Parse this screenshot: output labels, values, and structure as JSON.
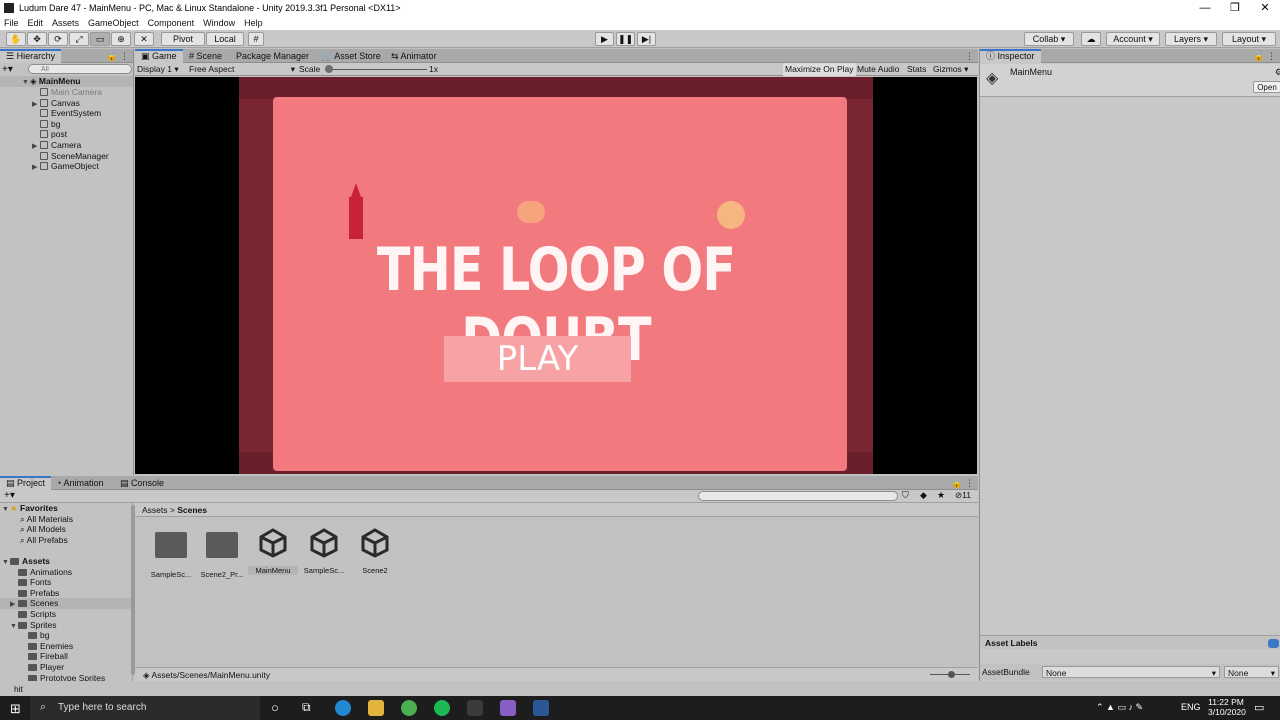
{
  "window": {
    "title": "Ludum Dare 47 - MainMenu - PC, Mac & Linux Standalone - Unity 2019.3.3f1 Personal <DX11>",
    "controls": [
      "—",
      "❐",
      "✕"
    ]
  },
  "menu": [
    "File",
    "Edit",
    "Assets",
    "GameObject",
    "Component",
    "Window",
    "Help"
  ],
  "toolbar": {
    "pivot": "Pivot",
    "local": "Local",
    "collab": "Collab ▾",
    "account": "Account",
    "layers": "Layers",
    "layout": "Layout"
  },
  "hierarchy": {
    "tab": "Hierarchy",
    "search_placeholder": "All",
    "scene": "MainMenu",
    "items": [
      {
        "label": "Main Camera",
        "disabled": true,
        "expandable": false
      },
      {
        "label": "Canvas",
        "expandable": true
      },
      {
        "label": "EventSystem",
        "expandable": false
      },
      {
        "label": "bg",
        "expandable": false
      },
      {
        "label": "post",
        "expandable": false
      },
      {
        "label": "Camera",
        "expandable": true
      },
      {
        "label": "SceneManager",
        "expandable": false
      },
      {
        "label": "GameObject",
        "expandable": true
      }
    ]
  },
  "center_tabs": [
    "Game",
    "Scene",
    "Package Manager",
    "Asset Store",
    "Animator"
  ],
  "game_bar": {
    "display": "Display 1",
    "aspect": "Free Aspect",
    "scale_label": "Scale",
    "scale_value": "1x",
    "buttons": [
      "Maximize On Play",
      "Mute Audio",
      "Stats",
      "Gizmos"
    ]
  },
  "game": {
    "title": "THE LOOP OF DOUBT",
    "play": "PLAY"
  },
  "inspector": {
    "tab": "Inspector",
    "object": "MainMenu",
    "open": "Open",
    "asset_labels": "Asset Labels",
    "assetbundle_label": "AssetBundle",
    "assetbundle_value": "None",
    "variant_value": "None"
  },
  "bottom_tabs": [
    "Project",
    "Animation",
    "Console"
  ],
  "project": {
    "favorites_label": "Favorites",
    "favorites": [
      "All Materials",
      "All Models",
      "All Prefabs"
    ],
    "assets_label": "Assets",
    "tree": [
      {
        "label": "Animations",
        "indent": 1
      },
      {
        "label": "Fonts",
        "indent": 1
      },
      {
        "label": "Prefabs",
        "indent": 1
      },
      {
        "label": "Scenes",
        "indent": 1,
        "selected": true
      },
      {
        "label": "Scripts",
        "indent": 1
      },
      {
        "label": "Sprites",
        "indent": 1
      },
      {
        "label": "bg",
        "indent": 2
      },
      {
        "label": "Enemies",
        "indent": 2
      },
      {
        "label": "Fireball",
        "indent": 2
      },
      {
        "label": "Player",
        "indent": 2
      },
      {
        "label": "Prototype Sprites",
        "indent": 2
      }
    ],
    "breadcrumb_root": "Assets",
    "breadcrumb_leaf": "Scenes",
    "hidden_count": "11",
    "assets": [
      {
        "label": "SampleSc...",
        "kind": "folder"
      },
      {
        "label": "Scene2_Pr...",
        "kind": "folder"
      },
      {
        "label": "MainMenu",
        "kind": "scene"
      },
      {
        "label": "SampleSc...",
        "kind": "scene"
      },
      {
        "label": "Scene2",
        "kind": "scene"
      }
    ],
    "path": "Assets/Scenes/MainMenu.unity"
  },
  "status": "hit",
  "taskbar": {
    "search_placeholder": "Type here to search",
    "lang": "ENG",
    "time": "11:22 PM",
    "date": "3/10/2020"
  }
}
